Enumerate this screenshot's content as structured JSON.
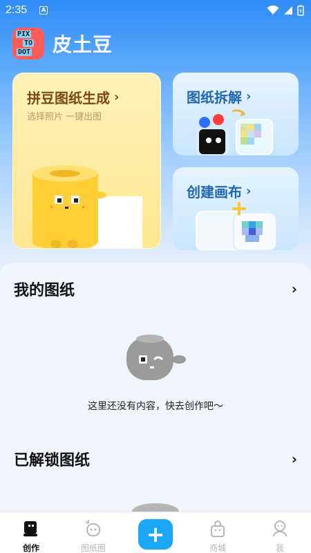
{
  "status_bar": {
    "time": "2:35",
    "notification_icon": "a-notification-icon",
    "wifi_icon": "wifi-icon",
    "signal_icon": "cell-signal-icon",
    "battery_icon": "battery-charging-icon"
  },
  "app": {
    "title": "皮土豆",
    "logo_lines": [
      "PIX",
      "TO",
      "DOT"
    ],
    "logo_icon": "pix-to-dot-logo"
  },
  "cards": {
    "generate": {
      "title": "拼豆图纸生成",
      "subtitle": "选择照片 一键出图",
      "chevron": "›"
    },
    "disassemble": {
      "title": "图纸拆解",
      "chevron": "›"
    },
    "canvas": {
      "title": "创建画布",
      "chevron": "›"
    }
  },
  "sections": {
    "my_patterns": {
      "title": "我的图纸",
      "chevron": "›",
      "empty_text": "这里还没有内容，快去创作吧～"
    },
    "unlocked": {
      "title": "已解锁图纸",
      "chevron": "›"
    }
  },
  "bottom_nav": {
    "items": [
      {
        "label": "创作",
        "icon": "create-icon",
        "active": true
      },
      {
        "label": "图纸圈",
        "icon": "community-icon",
        "active": false
      },
      {
        "label": "+",
        "icon": "add-icon",
        "active": false
      },
      {
        "label": "商城",
        "icon": "shop-bag-icon",
        "active": false
      },
      {
        "label": "我",
        "icon": "profile-icon",
        "active": false
      }
    ]
  },
  "colors": {
    "accent": "#1aa7f5",
    "header_gradient_top": "#2f8cf6",
    "generate_card": "#ffe891",
    "small_card": "#c8e5ff",
    "mascot_yellow": "#ffcf35",
    "mascot_gray": "#9b9b9b"
  }
}
